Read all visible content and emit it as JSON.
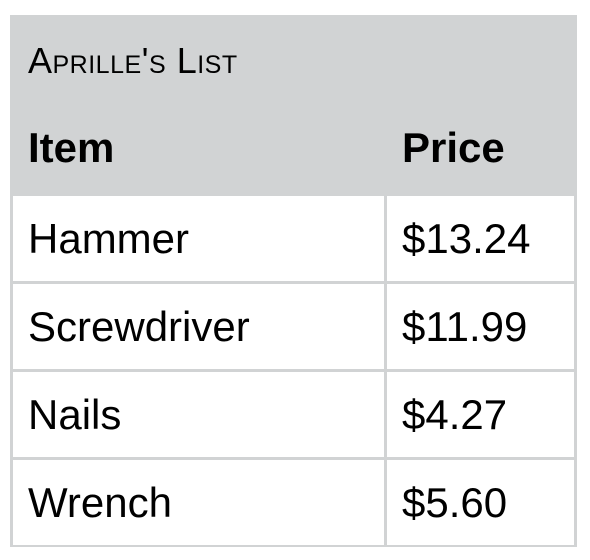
{
  "table": {
    "title": "Aprille's List",
    "headers": {
      "item": "Item",
      "price": "Price"
    },
    "rows": [
      {
        "item": "Hammer",
        "price": "$13.24"
      },
      {
        "item": "Screwdriver",
        "price": "$11.99"
      },
      {
        "item": "Nails",
        "price": "$4.27"
      },
      {
        "item": "Wrench",
        "price": "$5.60"
      }
    ]
  }
}
